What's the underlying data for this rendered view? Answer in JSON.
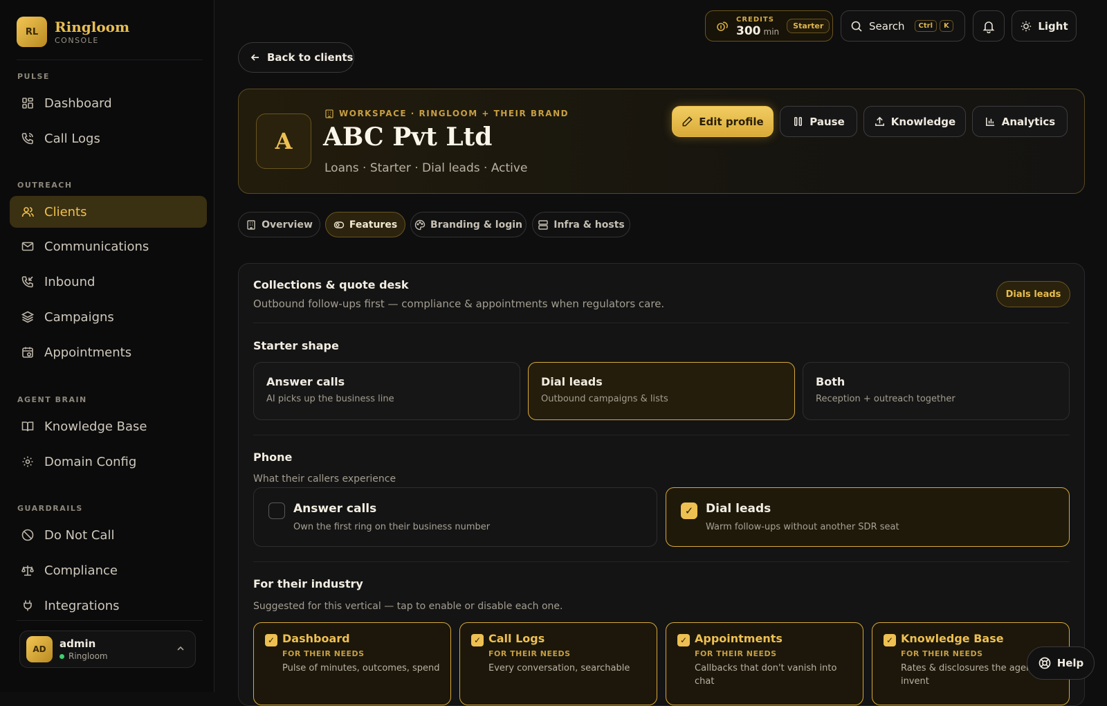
{
  "brand": {
    "logo": "RL",
    "name": "Ringloom",
    "sub": "CONSOLE"
  },
  "sidebar": {
    "sections": [
      {
        "title": "PULSE",
        "items": [
          {
            "label": "Dashboard",
            "icon": "grid-icon"
          },
          {
            "label": "Call Logs",
            "icon": "phone-icon"
          }
        ]
      },
      {
        "title": "OUTREACH",
        "items": [
          {
            "label": "Clients",
            "icon": "users-icon",
            "active": true
          },
          {
            "label": "Communications",
            "icon": "mail-icon"
          },
          {
            "label": "Inbound",
            "icon": "phone-incoming-icon"
          },
          {
            "label": "Campaigns",
            "icon": "layers-icon"
          },
          {
            "label": "Appointments",
            "icon": "calendar-icon"
          }
        ]
      },
      {
        "title": "AGENT BRAIN",
        "items": [
          {
            "label": "Knowledge Base",
            "icon": "book-icon"
          },
          {
            "label": "Domain Config",
            "icon": "gear-icon"
          }
        ]
      },
      {
        "title": "GUARDRAILS",
        "items": [
          {
            "label": "Do Not Call",
            "icon": "ban-icon"
          },
          {
            "label": "Compliance",
            "icon": "scale-icon"
          },
          {
            "label": "Integrations",
            "icon": "plug-icon"
          }
        ]
      }
    ],
    "user": {
      "initials": "AD",
      "name": "admin",
      "org": "Ringloom"
    }
  },
  "topbar": {
    "credits_label": "CREDITS",
    "credits_value": "300",
    "credits_unit": "min",
    "plan": "Starter",
    "search_label": "Search",
    "kbd1": "Ctrl",
    "kbd2": "K",
    "theme_label": "Light"
  },
  "back_label": "Back to clients",
  "client": {
    "initial": "A",
    "workspace": "WORKSPACE · RINGLOOM + THEIR BRAND",
    "name": "ABC Pvt Ltd",
    "meta": "Loans · Starter · Dial leads · Active",
    "actions": [
      "Edit profile",
      "Pause",
      "Knowledge",
      "Analytics"
    ]
  },
  "tabs": [
    "Overview",
    "Features",
    "Branding & login",
    "Infra & hosts"
  ],
  "active_tab": "Features",
  "panel": {
    "title": "Collections & quote desk",
    "subtitle": "Outbound follow-ups first — compliance & appointments when regulators care.",
    "tag": "Dials leads",
    "starter_title": "Starter shape",
    "shapes": [
      {
        "title": "Answer calls",
        "desc": "AI picks up the business line",
        "selected": false
      },
      {
        "title": "Dial leads",
        "desc": "Outbound campaigns & lists",
        "selected": true
      },
      {
        "title": "Both",
        "desc": "Reception + outreach together",
        "selected": false
      }
    ],
    "phone_title": "Phone",
    "phone_sub": "What their callers experience",
    "phone_options": [
      {
        "title": "Answer calls",
        "desc": "Own the first ring on their business number",
        "checked": false
      },
      {
        "title": "Dial leads",
        "desc": "Warm follow-ups without another SDR seat",
        "checked": true
      }
    ],
    "industry_title": "For their industry",
    "industry_sub": "Suggested for this vertical — tap to enable or disable each one.",
    "industry_cards": [
      {
        "title": "Dashboard",
        "kicker": "FOR THEIR NEEDS",
        "desc": "Pulse of minutes, outcomes, spend"
      },
      {
        "title": "Call Logs",
        "kicker": "FOR THEIR NEEDS",
        "desc": "Every conversation, searchable"
      },
      {
        "title": "Appointments",
        "kicker": "FOR THEIR NEEDS",
        "desc": "Callbacks that don't vanish into chat"
      },
      {
        "title": "Knowledge Base",
        "kicker": "FOR THEIR NEEDS",
        "desc": "Rates & disclosures the agent not invent"
      }
    ]
  },
  "help_label": "Help",
  "check_glyph": "✓"
}
